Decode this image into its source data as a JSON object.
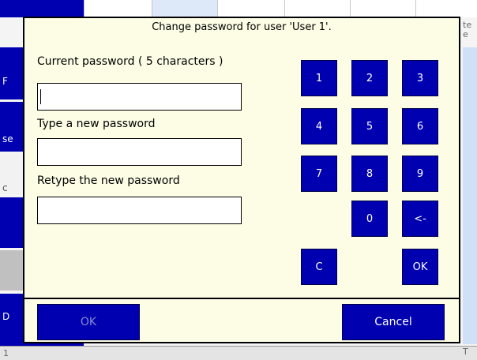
{
  "background": {
    "side_labels": [
      "F",
      "se",
      "c",
      "D"
    ],
    "right_text": [
      "te",
      "e",
      "T"
    ],
    "bottom_text": "1"
  },
  "dialog": {
    "title": "Change password for user 'User 1'.",
    "current_password_label": "Current password ( 5 characters )",
    "new_password_label": "Type a new password",
    "retype_password_label": "Retype the new password",
    "current_password_value": "",
    "new_password_value": "",
    "retype_password_value": "",
    "keypad": {
      "k1": "1",
      "k2": "2",
      "k3": "3",
      "k4": "4",
      "k5": "5",
      "k6": "6",
      "k7": "7",
      "k8": "8",
      "k9": "9",
      "k0": "0",
      "backspace": "<-",
      "clear": "C",
      "enter": "OK"
    },
    "ok_label": "OK",
    "cancel_label": "Cancel",
    "colors": {
      "button": "#0000b0",
      "dialog_bg": "#fdfde6",
      "ok_disabled_text": "#8a8ad0"
    }
  }
}
